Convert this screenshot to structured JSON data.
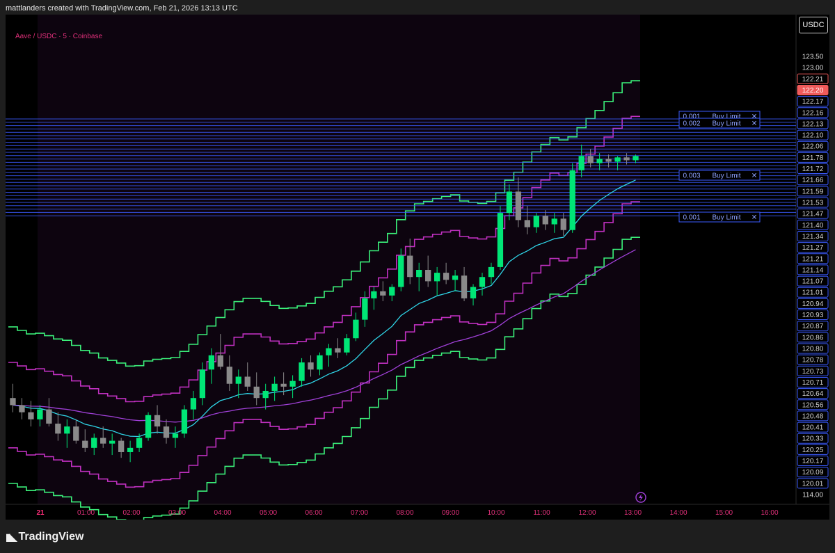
{
  "header": {
    "attribution": "mattlanders created with TradingView.com, Feb 21, 2026 13:13 UTC"
  },
  "symbol": {
    "title": "Aave / USDC · 5 · Coinbase",
    "quote_currency": "USDC"
  },
  "footer": {
    "brand": "TradingView"
  },
  "colors": {
    "up": "#00e676",
    "down": "#8a8a8a",
    "ema_fast": "#2fd6e8",
    "ema_slow": "#a040d8",
    "band_outer": "#3bf07a",
    "band_inner": "#c030c0",
    "order": "#3b5bff",
    "last_price": "#f05a5a"
  },
  "chart_data": {
    "type": "candlestick",
    "timeframe": "5",
    "x_ticks": [
      "21",
      "01:00",
      "02:00",
      "03:00",
      "04:00",
      "05:00",
      "06:00",
      "07:00",
      "08:00",
      "09:00",
      "10:00",
      "11:00",
      "12:00",
      "13:00",
      "14:00",
      "15:00",
      "16:00"
    ],
    "y_axis_labels": [
      "123.50",
      "123.00",
      "122.21",
      "122.20",
      "122.17",
      "122.16",
      "122.13",
      "122.10",
      "122.06",
      "121.78",
      "121.72",
      "121.66",
      "121.59",
      "121.53",
      "121.47",
      "121.40",
      "121.34",
      "121.27",
      "121.21",
      "121.14",
      "121.07",
      "121.01",
      "120.94",
      "120.93",
      "120.87",
      "120.86",
      "120.80",
      "120.78",
      "120.73",
      "120.71",
      "120.64",
      "120.56",
      "120.48",
      "120.41",
      "120.33",
      "120.25",
      "120.17",
      "120.09",
      "120.01",
      "114.00"
    ],
    "last_price": "122.20",
    "top_price": "122.21",
    "orders": [
      {
        "qty": "0.001",
        "side": "Buy Limit",
        "close": "✕"
      },
      {
        "qty": "0.003",
        "side": "Buy Limit",
        "close": "✕"
      },
      {
        "qty": "0.001",
        "side": "Buy Limit",
        "close": "✕"
      },
      {
        "qty": "0.002",
        "side": "Buy Limit",
        "close": "✕"
      }
    ],
    "ohlc": [
      [
        120.5,
        120.6,
        120.4,
        120.45
      ],
      [
        120.45,
        120.5,
        120.35,
        120.4
      ],
      [
        120.4,
        120.48,
        120.3,
        120.35
      ],
      [
        120.35,
        120.45,
        120.3,
        120.42
      ],
      [
        120.42,
        120.5,
        120.3,
        120.32
      ],
      [
        120.32,
        120.4,
        120.2,
        120.25
      ],
      [
        120.25,
        120.35,
        120.15,
        120.3
      ],
      [
        120.3,
        120.35,
        120.18,
        120.2
      ],
      [
        120.2,
        120.28,
        120.12,
        120.15
      ],
      [
        120.15,
        120.25,
        120.1,
        120.22
      ],
      [
        120.22,
        120.3,
        120.15,
        120.18
      ],
      [
        120.18,
        120.25,
        120.1,
        120.2
      ],
      [
        120.2,
        120.22,
        120.08,
        120.12
      ],
      [
        120.12,
        120.2,
        120.05,
        120.15
      ],
      [
        120.15,
        120.25,
        120.12,
        120.22
      ],
      [
        120.22,
        120.4,
        120.2,
        120.38
      ],
      [
        120.38,
        120.45,
        120.25,
        120.3
      ],
      [
        120.3,
        120.35,
        120.18,
        120.22
      ],
      [
        120.22,
        120.3,
        120.15,
        120.25
      ],
      [
        120.25,
        120.45,
        120.22,
        120.42
      ],
      [
        120.42,
        120.55,
        120.35,
        120.5
      ],
      [
        120.5,
        120.75,
        120.45,
        120.7
      ],
      [
        120.7,
        120.85,
        120.6,
        120.8
      ],
      [
        120.8,
        120.95,
        120.7,
        120.72
      ],
      [
        120.72,
        120.8,
        120.55,
        120.6
      ],
      [
        120.6,
        120.7,
        120.5,
        120.65
      ],
      [
        120.65,
        120.75,
        120.55,
        120.58
      ],
      [
        120.58,
        120.68,
        120.45,
        120.5
      ],
      [
        120.5,
        120.6,
        120.42,
        120.55
      ],
      [
        120.55,
        120.65,
        120.48,
        120.6
      ],
      [
        120.6,
        120.68,
        120.52,
        120.58
      ],
      [
        120.58,
        120.66,
        120.5,
        120.62
      ],
      [
        120.62,
        120.78,
        120.58,
        120.75
      ],
      [
        120.75,
        120.8,
        120.65,
        120.7
      ],
      [
        120.7,
        120.82,
        120.66,
        120.8
      ],
      [
        120.8,
        120.88,
        120.72,
        120.85
      ],
      [
        120.85,
        120.92,
        120.78,
        120.82
      ],
      [
        120.82,
        120.95,
        120.8,
        120.92
      ],
      [
        120.92,
        121.1,
        120.9,
        121.05
      ],
      [
        121.05,
        121.25,
        121.0,
        121.2
      ],
      [
        121.2,
        121.28,
        121.12,
        121.25
      ],
      [
        121.25,
        121.32,
        121.18,
        121.22
      ],
      [
        121.22,
        121.3,
        121.18,
        121.28
      ],
      [
        121.28,
        121.55,
        121.25,
        121.5
      ],
      [
        121.5,
        121.62,
        121.3,
        121.35
      ],
      [
        121.35,
        121.45,
        121.25,
        121.4
      ],
      [
        121.4,
        121.5,
        121.28,
        121.32
      ],
      [
        121.32,
        121.42,
        121.22,
        121.38
      ],
      [
        121.38,
        121.45,
        121.3,
        121.33
      ],
      [
        121.33,
        121.4,
        121.25,
        121.36
      ],
      [
        121.36,
        121.42,
        121.18,
        121.2
      ],
      [
        121.2,
        121.3,
        121.15,
        121.28
      ],
      [
        121.28,
        121.38,
        121.22,
        121.35
      ],
      [
        121.35,
        121.45,
        121.3,
        121.42
      ],
      [
        121.42,
        121.85,
        121.4,
        121.8
      ],
      [
        121.8,
        122.0,
        121.75,
        121.95
      ],
      [
        121.95,
        122.05,
        121.7,
        121.75
      ],
      [
        121.75,
        121.85,
        121.65,
        121.7
      ],
      [
        121.7,
        121.8,
        121.66,
        121.78
      ],
      [
        121.78,
        121.82,
        121.68,
        121.72
      ],
      [
        121.72,
        121.8,
        121.66,
        121.76
      ],
      [
        121.76,
        121.8,
        121.64,
        121.68
      ],
      [
        121.68,
        122.15,
        121.66,
        122.1
      ],
      [
        122.1,
        122.28,
        122.05,
        122.2
      ],
      [
        122.2,
        122.25,
        122.12,
        122.15
      ],
      [
        122.15,
        122.22,
        122.1,
        122.18
      ],
      [
        122.18,
        122.21,
        122.12,
        122.16
      ],
      [
        122.16,
        122.2,
        122.1,
        122.19
      ],
      [
        122.19,
        122.22,
        122.14,
        122.17
      ],
      [
        122.17,
        122.21,
        122.15,
        122.2
      ]
    ]
  }
}
